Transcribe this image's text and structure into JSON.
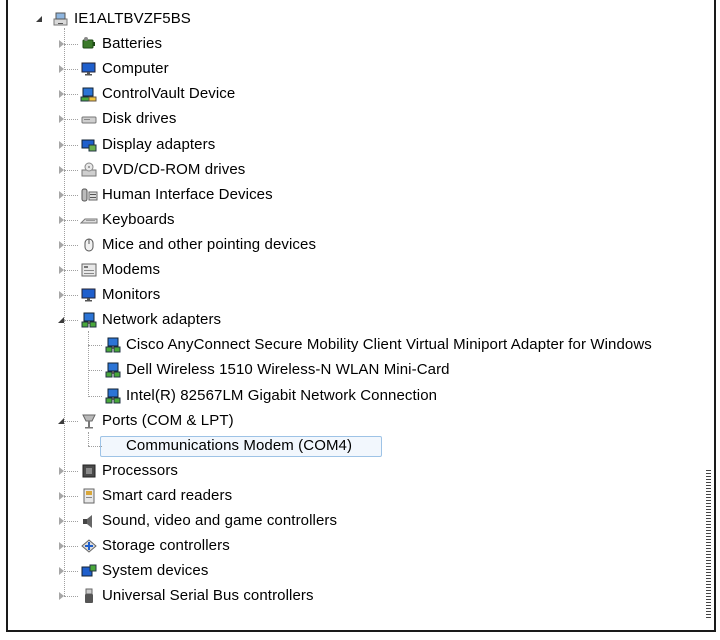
{
  "root": {
    "label": "IE1ALTBVZF5BS",
    "icon": "computer-root-icon",
    "expanded": true
  },
  "categories": [
    {
      "id": "batteries",
      "label": "Batteries",
      "icon": "battery-icon",
      "expanded": false
    },
    {
      "id": "computer",
      "label": "Computer",
      "icon": "monitor-icon",
      "expanded": false
    },
    {
      "id": "controlvault",
      "label": "ControlVault Device",
      "icon": "network-device-icon",
      "expanded": false
    },
    {
      "id": "disk-drives",
      "label": "Disk drives",
      "icon": "disk-drive-icon",
      "expanded": false
    },
    {
      "id": "display-adapters",
      "label": "Display adapters",
      "icon": "display-adapter-icon",
      "expanded": false
    },
    {
      "id": "dvd",
      "label": "DVD/CD-ROM drives",
      "icon": "dvd-drive-icon",
      "expanded": false
    },
    {
      "id": "hid",
      "label": "Human Interface Devices",
      "icon": "hid-icon",
      "expanded": false
    },
    {
      "id": "keyboards",
      "label": "Keyboards",
      "icon": "keyboard-icon",
      "expanded": false
    },
    {
      "id": "mice",
      "label": "Mice and other pointing devices",
      "icon": "mouse-icon",
      "expanded": false
    },
    {
      "id": "modems",
      "label": "Modems",
      "icon": "modem-icon",
      "expanded": false
    },
    {
      "id": "monitors",
      "label": "Monitors",
      "icon": "monitor-icon",
      "expanded": false
    },
    {
      "id": "network-adapters",
      "label": "Network adapters",
      "icon": "network-adapter-icon",
      "expanded": true,
      "children": [
        {
          "label": "Cisco AnyConnect Secure Mobility Client Virtual Miniport Adapter for Windows",
          "icon": "network-adapter-icon"
        },
        {
          "label": "Dell Wireless 1510 Wireless-N WLAN Mini-Card",
          "icon": "network-adapter-icon"
        },
        {
          "label": "Intel(R) 82567LM Gigabit Network Connection",
          "icon": "network-adapter-icon"
        }
      ]
    },
    {
      "id": "ports",
      "label": "Ports (COM & LPT)",
      "icon": "port-icon",
      "expanded": true,
      "children": [
        {
          "label": "Communications Modem (COM4)",
          "icon": "port-icon",
          "selected": true
        }
      ]
    },
    {
      "id": "processors",
      "label": "Processors",
      "icon": "processor-icon",
      "expanded": false
    },
    {
      "id": "smart-card",
      "label": "Smart card readers",
      "icon": "smart-card-icon",
      "expanded": false
    },
    {
      "id": "sound",
      "label": "Sound, video and game controllers",
      "icon": "speaker-icon",
      "expanded": false
    },
    {
      "id": "storage",
      "label": "Storage controllers",
      "icon": "storage-controller-icon",
      "expanded": false
    },
    {
      "id": "system",
      "label": "System devices",
      "icon": "system-device-icon",
      "expanded": false
    },
    {
      "id": "usb",
      "label": "Universal Serial Bus controllers",
      "icon": "usb-icon",
      "expanded": false
    }
  ],
  "colors": {
    "selection_border": "#9ec3e6",
    "selection_fill": "#f2f7fd",
    "tree_line": "#a0a0a0"
  }
}
